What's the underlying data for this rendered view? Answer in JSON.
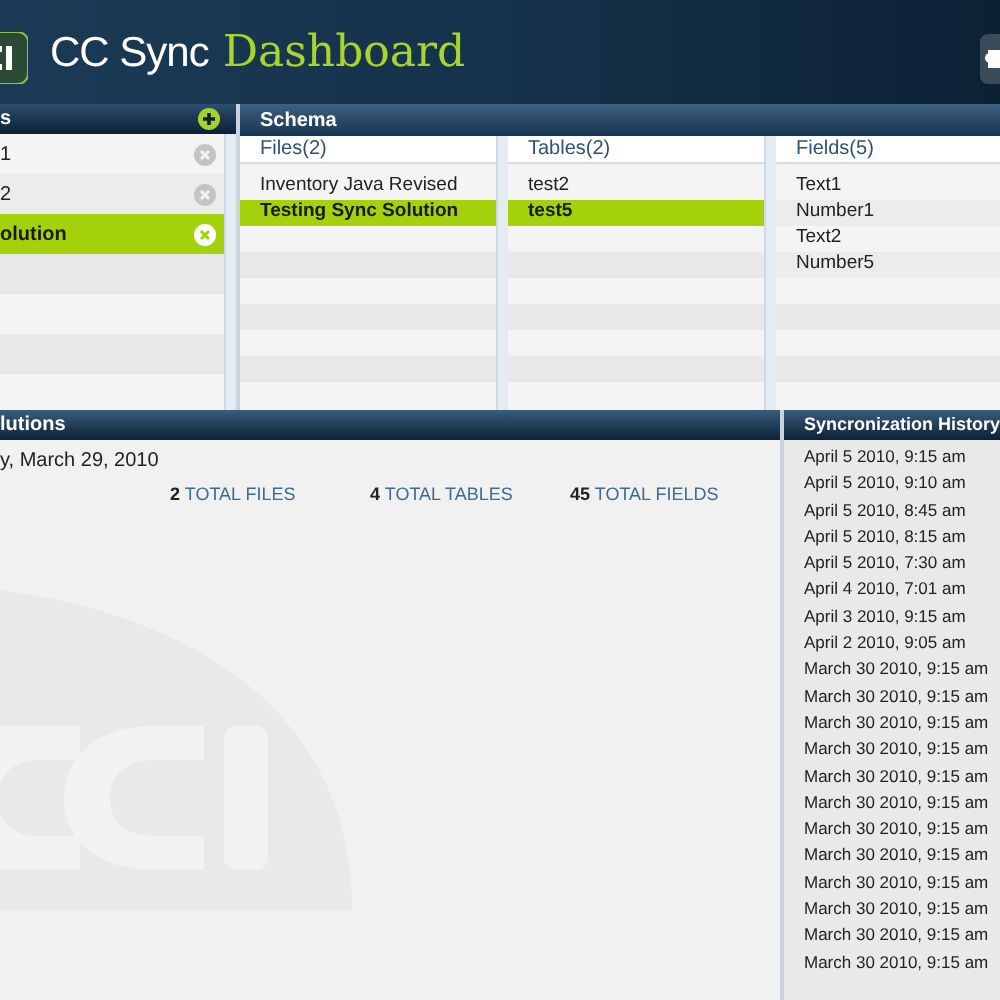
{
  "header": {
    "title": "CC Sync",
    "title_accent": "Dashboard"
  },
  "solutions_panel": {
    "title": "s",
    "items": [
      {
        "label": "1",
        "selected": false
      },
      {
        "label": "2",
        "selected": false
      },
      {
        "label": "olution",
        "selected": true
      }
    ]
  },
  "schema": {
    "title": "Schema",
    "columns": [
      {
        "heading": "Files(2)",
        "items": [
          {
            "label": "Inventory Java Revised",
            "selected": false
          },
          {
            "label": "Testing Sync Solution",
            "selected": true
          }
        ]
      },
      {
        "heading": "Tables(2)",
        "items": [
          {
            "label": "test2",
            "selected": false
          },
          {
            "label": "test5",
            "selected": true
          }
        ]
      },
      {
        "heading": "Fields(5)",
        "items": [
          {
            "label": "Text1",
            "selected": false
          },
          {
            "label": "Number1",
            "selected": false
          },
          {
            "label": "Text2",
            "selected": false
          },
          {
            "label": "Number5",
            "selected": false
          }
        ]
      }
    ]
  },
  "details": {
    "title": "lutions",
    "date": "y, March 29, 2010",
    "stats": [
      {
        "value": "2",
        "label": "TOTAL FILES"
      },
      {
        "value": "4",
        "label": "TOTAL TABLES"
      },
      {
        "value": "45",
        "label": "TOTAL FIELDS"
      }
    ]
  },
  "history": {
    "title": "Syncronization History",
    "entries": [
      "April 5 2010, 9:15 am",
      "April 5 2010, 9:10 am",
      "April 5 2010, 8:45 am",
      "April 5 2010, 8:15 am",
      "April 5 2010, 7:30 am",
      "April 4 2010, 7:01 am",
      "April 3 2010, 9:15 am",
      "April 2 2010, 9:05 am",
      "March 30 2010, 9:15 am",
      "March 30 2010, 9:15 am",
      "March 30 2010, 9:15 am",
      "March 30 2010, 9:15 am",
      "March 30 2010, 9:15 am",
      "March 30 2010, 9:15 am",
      "March 30 2010, 9:15 am",
      "March 30 2010, 9:15 am",
      "March 30 2010, 9:15 am",
      "March 30 2010, 9:15 am",
      "March 30 2010, 9:15 am",
      "March 30 2010, 9:15 am"
    ]
  }
}
